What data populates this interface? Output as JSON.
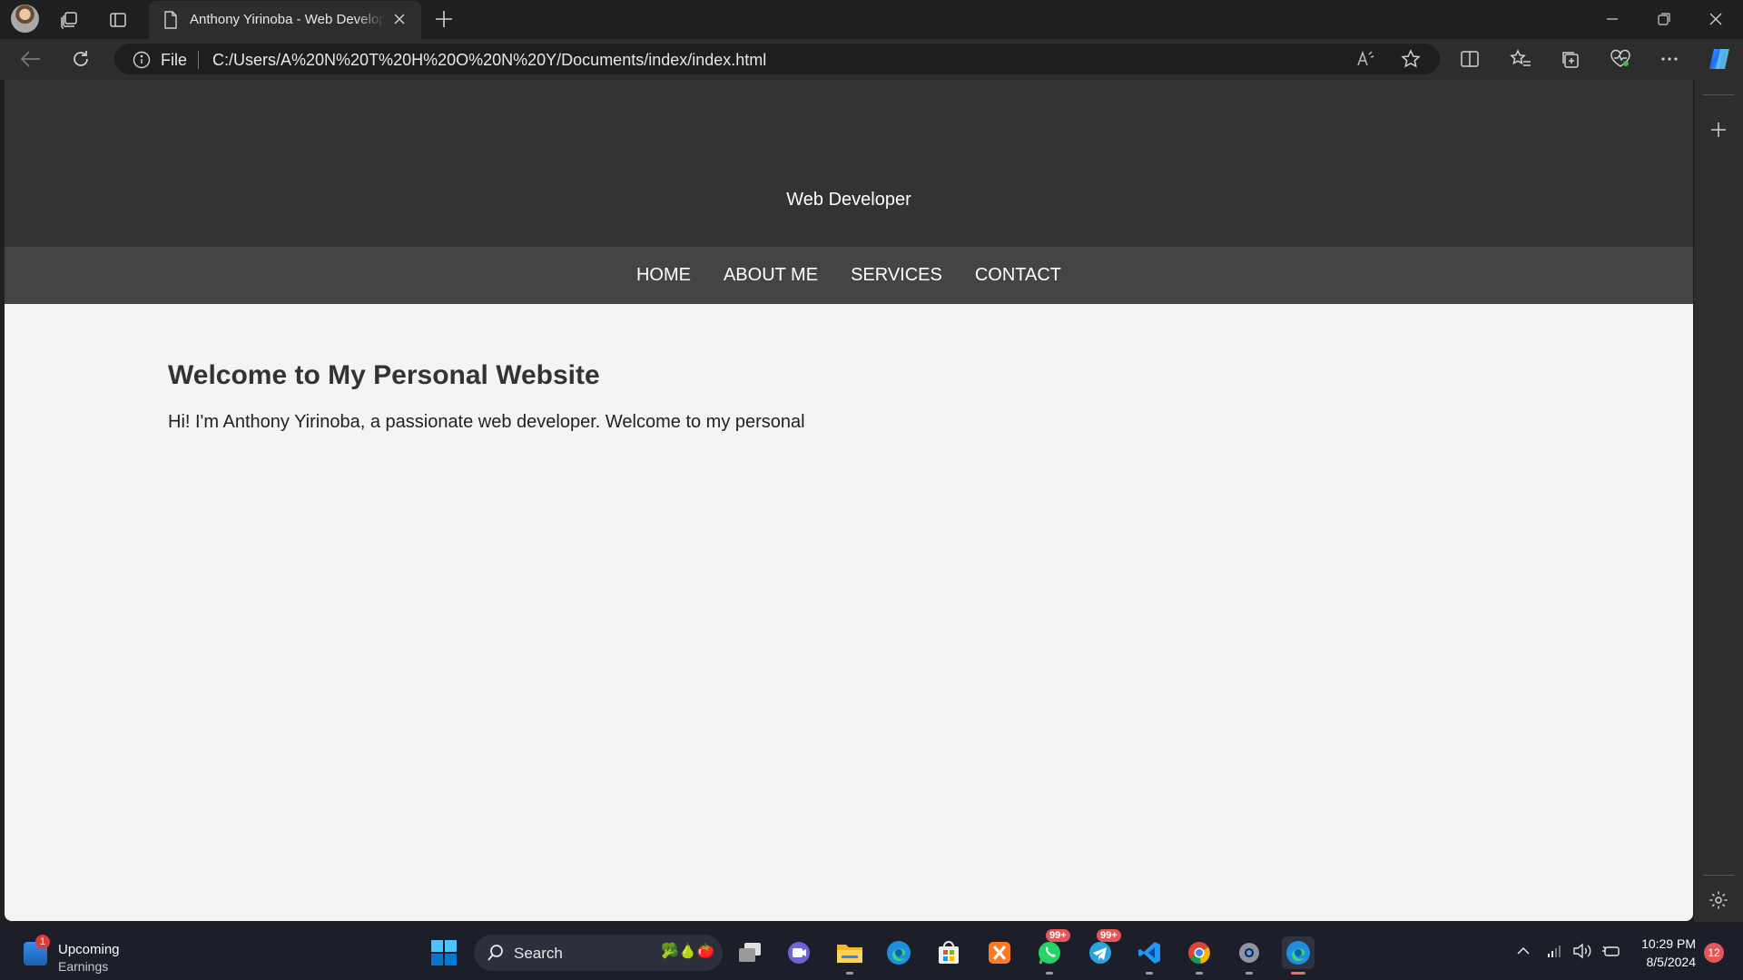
{
  "browser": {
    "tab": {
      "title": "Anthony Yirinoba - Web Developer"
    },
    "address": {
      "scheme_label": "File",
      "url": "C:/Users/A%20N%20T%20H%20O%20N%20Y/Documents/index/index.html"
    }
  },
  "site": {
    "header": {
      "subtitle": "Web Developer"
    },
    "nav": [
      "HOME",
      "ABOUT ME",
      "SERVICES",
      "CONTACT"
    ],
    "main": {
      "heading": "Welcome to My Personal Website",
      "intro": "Hi! I'm Anthony Yirinoba, a passionate web developer. Welcome to my personal"
    }
  },
  "taskbar": {
    "widget": {
      "line1": "Upcoming",
      "line2": "Earnings",
      "badge": "1"
    },
    "search_label": "Search",
    "whatsapp_badge": "99+",
    "telegram_badge": "99+",
    "clock": {
      "time": "10:29 PM",
      "date": "8/5/2024"
    },
    "notification_count": "12"
  },
  "colors": {
    "header_bg": "#333333",
    "nav_bg": "#444444",
    "page_bg": "#f4f4f4",
    "accent": "#f06a6a"
  }
}
